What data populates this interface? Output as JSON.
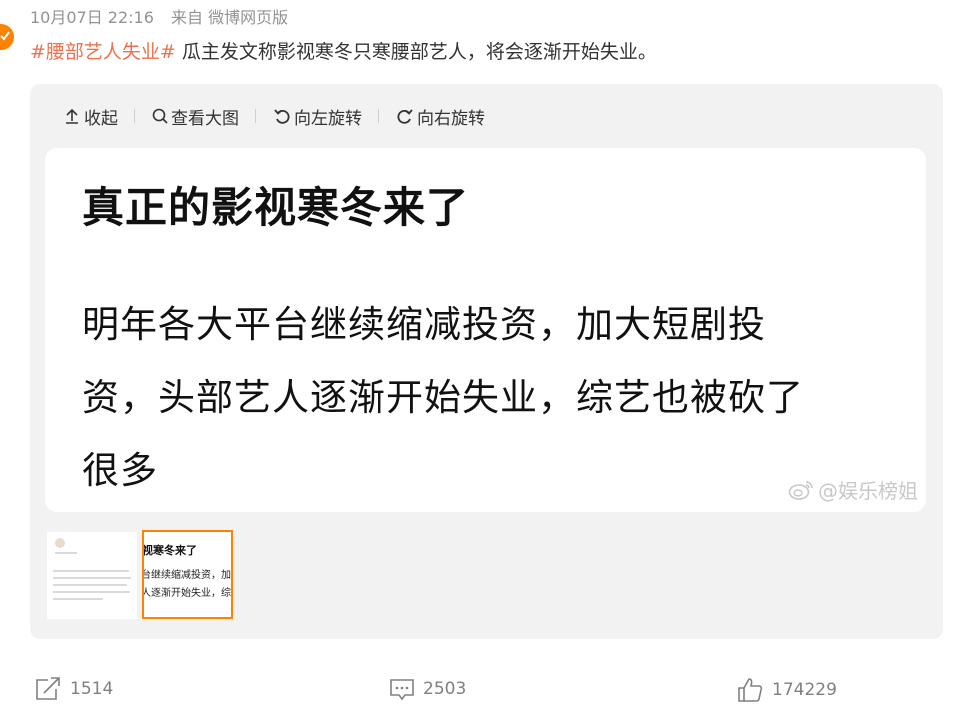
{
  "meta": {
    "time": "10月07日 22:16",
    "source": "来自 微博网页版"
  },
  "post": {
    "hashtag": "#腰部艺人失业#",
    "text": " 瓜主发文称影视寒冬只寒腰部艺人，将会逐渐开始失业。"
  },
  "toolbar": {
    "collapse": "收起",
    "view_large": "查看大图",
    "rotate_left": "向左旋转",
    "rotate_right": "向右旋转"
  },
  "image": {
    "title": "真正的影视寒冬来了",
    "lines": [
      "明年各大平台继续缩减投资，加大短剧投",
      "资，头部艺人逐渐开始失业，综艺也被砍了",
      "很多"
    ],
    "watermark": "@娱乐榜姐"
  },
  "thumbnail": {
    "title": "视寒冬来了",
    "line1": "台继续缩减投资，加",
    "line2": "人逐渐开始失业，综"
  },
  "actions": {
    "repost_count": "1514",
    "comment_count": "2503",
    "like_count": "174229"
  },
  "colors": {
    "accent": "#ff8200",
    "hashtag": "#eb7350",
    "meta_gray": "#939393",
    "card_bg": "#f2f2f2"
  },
  "icons": [
    "collapse-up-icon",
    "search-icon",
    "rotate-left-icon",
    "rotate-right-icon",
    "weibo-logo-icon",
    "repost-icon",
    "comment-icon",
    "like-icon"
  ]
}
